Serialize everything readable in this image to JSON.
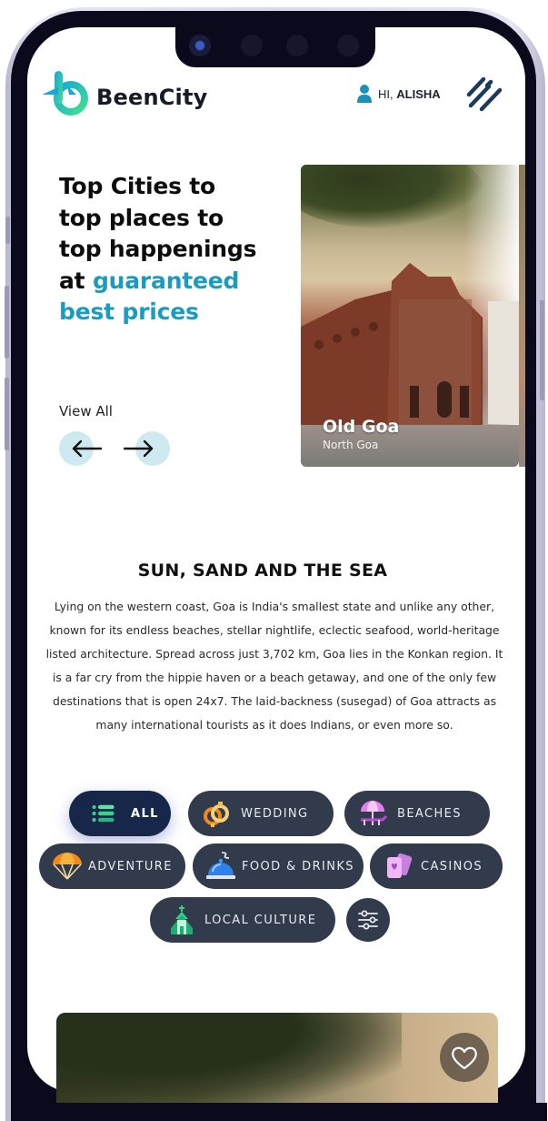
{
  "brand": {
    "name": "BeenCity",
    "colors": {
      "primary_text": "#151a26",
      "accent": "#1a9bbf",
      "chip_bg": "#323b4c",
      "chip_active_bg": "#16274a"
    }
  },
  "header": {
    "greeting_prefix": "HI,",
    "user_name": "ALISHA",
    "user_icon": "user-icon",
    "menu_icon": "menu-icon"
  },
  "hero": {
    "title_lines": [
      "Top Cities to",
      "top places to",
      "top happenings"
    ],
    "title_plain_prefix": "at ",
    "title_accent_line1": "guaranteed",
    "title_accent_line2": "best prices",
    "view_all_label": "View All",
    "prev_icon": "arrow-left-icon",
    "next_icon": "arrow-right-icon"
  },
  "carousel": {
    "cards": [
      {
        "title": "Old Goa",
        "subtitle": "North Goa"
      }
    ]
  },
  "section": {
    "title": "SUN, SAND AND THE SEA",
    "body": "Lying on the western coast, Goa is India's smallest state and unlike any other, known for its endless beaches, stellar nightlife, eclectic seafood, world-heritage listed architecture. Spread across just 3,702 km, Goa lies in the Konkan region. It is a far cry from the hippie haven or a beach getaway, and one of the only few destinations that is open 24x7. The laid-backness (susegad) of Goa attracts as many international tourists as it does Indians, or even more so."
  },
  "categories": {
    "selected": "ALL",
    "items": [
      {
        "label": "ALL",
        "icon": "list-icon",
        "active": true
      },
      {
        "label": "WEDDING",
        "icon": "rings-icon",
        "active": false
      },
      {
        "label": "BEACHES",
        "icon": "beach-umbrella-icon",
        "active": false
      },
      {
        "label": "ADVENTURE",
        "icon": "parachute-icon",
        "active": false
      },
      {
        "label": "FOOD & DRINKS",
        "icon": "food-cloche-icon",
        "active": false
      },
      {
        "label": "CASINOS",
        "icon": "playing-cards-icon",
        "active": false
      },
      {
        "label": "LOCAL CULTURE",
        "icon": "church-icon",
        "active": false
      }
    ],
    "filter_icon": "sliders-icon"
  },
  "listing": {
    "favorite_icon": "heart-icon"
  }
}
